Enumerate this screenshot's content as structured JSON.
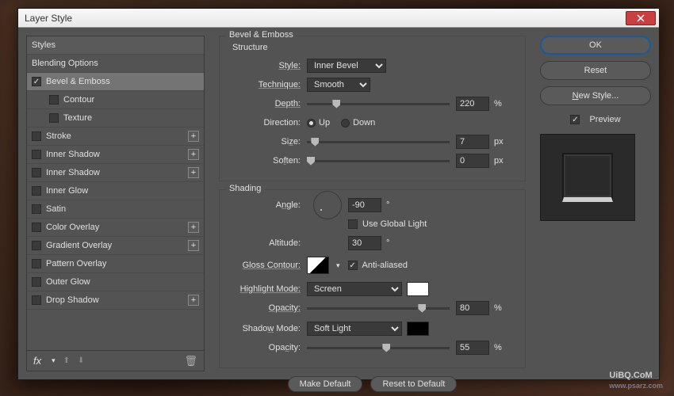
{
  "title": "Layer Style",
  "styles": {
    "header": "Styles",
    "blending": "Blending Options",
    "items": [
      {
        "label": "Bevel & Emboss",
        "checked": true,
        "selected": true
      },
      {
        "label": "Contour",
        "sub": true
      },
      {
        "label": "Texture",
        "sub": true
      },
      {
        "label": "Stroke",
        "add": true
      },
      {
        "label": "Inner Shadow",
        "add": true
      },
      {
        "label": "Inner Shadow",
        "add": true
      },
      {
        "label": "Inner Glow"
      },
      {
        "label": "Satin"
      },
      {
        "label": "Color Overlay",
        "add": true
      },
      {
        "label": "Gradient Overlay",
        "add": true
      },
      {
        "label": "Pattern Overlay"
      },
      {
        "label": "Outer Glow"
      },
      {
        "label": "Drop Shadow",
        "add": true
      }
    ],
    "fx": "fx"
  },
  "panel": {
    "title": "Bevel & Emboss",
    "structure": "Structure",
    "style_lbl": "Style:",
    "style_val": "Inner Bevel",
    "tech_lbl": "Technique:",
    "tech_val": "Smooth",
    "depth_lbl": "Depth:",
    "depth_val": "220",
    "depth_unit": "%",
    "dir_lbl": "Direction:",
    "dir_up": "Up",
    "dir_down": "Down",
    "size_lbl": "Size:",
    "size_val": "7",
    "size_unit": "px",
    "soften_lbl": "Soften:",
    "soften_val": "0",
    "soften_unit": "px",
    "shading": "Shading",
    "angle_lbl": "Angle:",
    "angle_val": "-90",
    "deg": "°",
    "global": "Use Global Light",
    "alt_lbl": "Altitude:",
    "alt_val": "30",
    "gloss_lbl": "Gloss Contour:",
    "aa": "Anti-aliased",
    "hi_lbl": "Highlight Mode:",
    "hi_val": "Screen",
    "hi_color": "#ffffff",
    "op_lbl": "Opacity:",
    "hi_op": "80",
    "sh_lbl": "Shadow Mode:",
    "sh_val": "Soft Light",
    "sh_color": "#000000",
    "sh_op": "55",
    "pct": "%",
    "make_def": "Make Default",
    "reset_def": "Reset to Default"
  },
  "right": {
    "ok": "OK",
    "reset": "Reset",
    "new_style": "New Style...",
    "preview": "Preview"
  },
  "watermark": "UiBQ.CoM",
  "watermark_sub": "www.psarz.com"
}
